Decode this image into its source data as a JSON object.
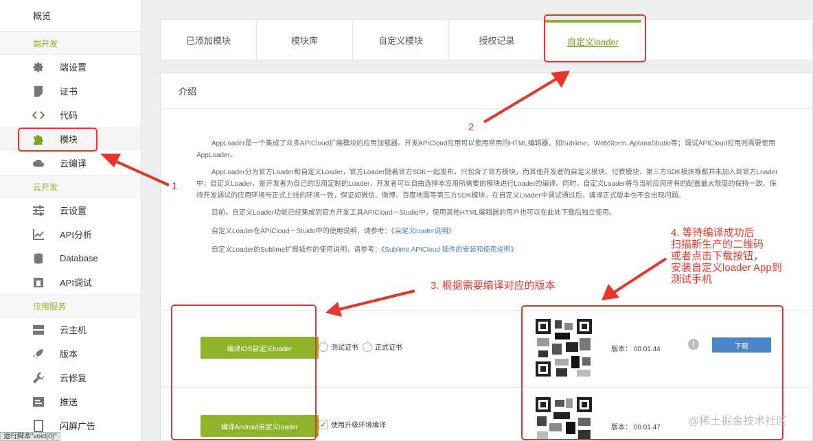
{
  "sidebar": {
    "overview": "概览",
    "sections": [
      {
        "title": "端开发",
        "items": [
          {
            "label": "端设置",
            "icon": "gear-icon"
          },
          {
            "label": "证书",
            "icon": "certificate-icon"
          },
          {
            "label": "代码",
            "icon": "code-icon"
          },
          {
            "label": "模块",
            "icon": "puzzle-icon"
          },
          {
            "label": "云编译",
            "icon": "cloud-icon"
          }
        ]
      },
      {
        "title": "云开发",
        "items": [
          {
            "label": "云设置",
            "icon": "sliders-icon"
          },
          {
            "label": "API分析",
            "icon": "chart-icon"
          },
          {
            "label": "Database",
            "icon": "database-icon"
          },
          {
            "label": "API调试",
            "icon": "api-debug-icon"
          }
        ]
      },
      {
        "title": "应用服务",
        "items": [
          {
            "label": "云主机",
            "icon": "server-icon"
          },
          {
            "label": "版本",
            "icon": "rocket-icon"
          },
          {
            "label": "云修复",
            "icon": "wrench-icon"
          },
          {
            "label": "推送",
            "icon": "push-icon"
          },
          {
            "label": "闪屏广告",
            "icon": "ad-icon"
          }
        ]
      }
    ],
    "status_tip": "运行脚本\"void(0)\""
  },
  "tabs": [
    "已添加模块",
    "模块库",
    "自定义模块",
    "授权记录",
    "自定义loader"
  ],
  "panel": {
    "title": "介绍",
    "paragraphs": {
      "p1": "AppLoader是一个集成了众多APICloud扩展模块的应用加载器。开发APICloud应用可以使用常用的HTML编辑器，如Sublime，WebStorm, AptanaStudio等；调试APICloud应用则需要使用AppLoader。",
      "p2": "AppLoader分为官方Loader和自定义Loader，官方Loader随着官方SDK一起发布，只包含了官方模块，而其他开发者的自定义模块、付费模块、第三方SDK模块等都并未加入到官方Loader中；自定义Loader，是开发者为自己的应用定制的Loader，开发者可以自由选择本应用所需要的模块进行Loader的编译。同时，自定义Loader将与当前应用所有的配置最大限度的保持一致，保持开发调试的应用环境与正式上线的环境一致，保证如微信、微博、百度地图等第三方SDK模块，在自定义Loader中调试通过后，编译正式版本也不会出现问题。",
      "p3": "目前，自定义Loader功能已经集成到官方开发工具APICloud－Studio中，使用其他HTML编辑器的用户也可以在此处下载后独立使用。",
      "p4_prefix": "自定义Loader在APICloud－Stuido中的使用说明，请参考：《",
      "p4_link": "自定义loader说明",
      "p4_suffix": "》",
      "p5_prefix": "自定义Loader的Sublime扩展插件的使用说明，请参考：《",
      "p5_link": "Sublime APICloud 插件的安装和使用说明",
      "p5_suffix": "》"
    },
    "ios": {
      "compile_button": "编译iOS自定义loader",
      "radio_test": "测试证书",
      "radio_prod": "正式证书",
      "version_label": "版本：",
      "version": "00.01.44",
      "download_button": "下载"
    },
    "android": {
      "compile_button": "编译Android自定义loader",
      "checkbox_label": "使用升级环境编译",
      "checkbox_checked": true,
      "version_label": "版本：",
      "version": "00.01.47"
    }
  },
  "annotations": {
    "n1": "1",
    "n2": "2",
    "step3": "3. 根据需要编译对应的版本",
    "step4_lines": [
      "4. 等待编译成功后",
      "扫描新生产的二维码",
      "或者点击下载按钮，",
      "安装自定义loader App到",
      "测试手机"
    ]
  },
  "watermark": "@稀土掘金技术社区",
  "colors": {
    "accent": "#8fb32b",
    "annotation": "#e8352b",
    "link": "#4a7ec1",
    "download": "#4d86c8"
  }
}
